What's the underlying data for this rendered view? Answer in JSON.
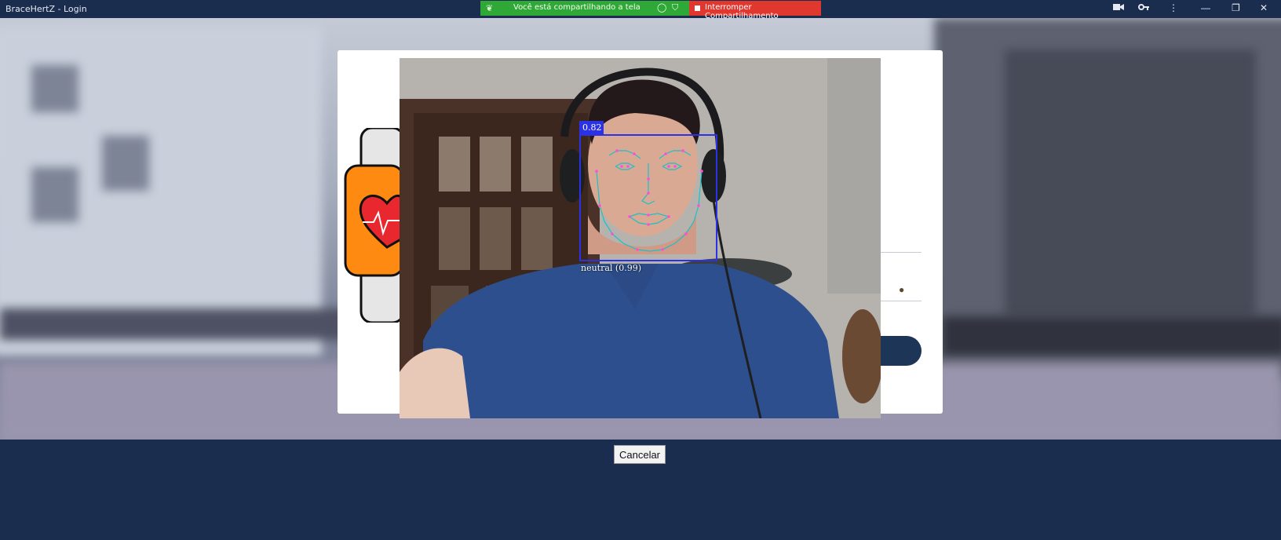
{
  "window": {
    "title": "BraceHertZ - Login",
    "controls": [
      "minimize-icon",
      "restore-icon",
      "close-icon"
    ]
  },
  "screen_share": {
    "status_text": "Você está compartilhando a tela",
    "stop_label": "Interromper Compartilhamento",
    "status_color": "#2fa838",
    "stop_color": "#e0372f"
  },
  "toolbar_icons": [
    "camera-icon",
    "key-icon",
    "more-vertical-icon"
  ],
  "face_detection": {
    "confidence": "0.82",
    "expression": "neutral (0.99)",
    "box_color": "#2b32e6",
    "landmark_color": "#ff4fd8"
  },
  "dialog": {
    "cancel_label": "Cancelar"
  },
  "colors": {
    "background": "#1b2d4f",
    "watch_orange": "#ff8a12",
    "heart_red": "#e8282e"
  }
}
